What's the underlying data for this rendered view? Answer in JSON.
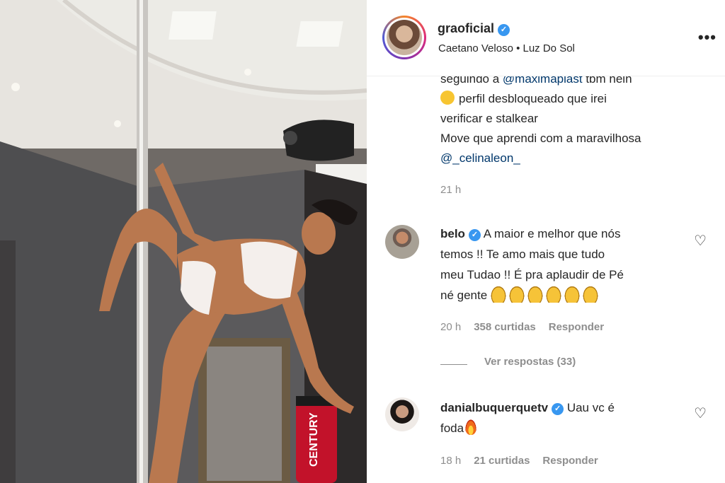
{
  "post": {
    "username": "graoficial",
    "audio": "Caetano Veloso • Luz Do Sol",
    "caption_lines": [
      {
        "pre": "seguindo a ",
        "mention": "@maximaplast",
        "post": " tbm hein"
      },
      {
        "pre": "",
        "mention": "",
        "post": "perfil desbloqueado que irei",
        "emoji": "slightly-smiling-face"
      },
      {
        "pre": "verificar e stalkear",
        "mention": "",
        "post": ""
      },
      {
        "pre": "Move que aprendi com a maravilhosa",
        "mention": "",
        "post": ""
      },
      {
        "pre": "",
        "mention": "@_celinaleon_",
        "post": ""
      }
    ],
    "caption_time": "21 h"
  },
  "comments": [
    {
      "username": "belo",
      "text_lines": [
        "A maior e melhor que nós",
        "temos !! Te amo mais que tudo",
        "meu Tudao !! É pra aplaudir de Pé",
        "né gente"
      ],
      "emoji": "clapping-hands x6",
      "time": "20 h",
      "likes": "358 curtidas",
      "reply": "Responder",
      "view_replies": "Ver respostas (33)"
    },
    {
      "username": "danialbuquerquetv",
      "text_lines": [
        "Uau vc é",
        "foda"
      ],
      "emoji": "fire",
      "time": "18 h",
      "likes": "21 curtidas",
      "reply": "Responder"
    }
  ],
  "icons": {
    "verified": "verified-badge-icon",
    "more": "more-options-icon",
    "heart": "heart-outline-icon"
  },
  "colors": {
    "mention": "#00376b",
    "verified": "#3897f0",
    "meta": "#8e8e8e"
  }
}
